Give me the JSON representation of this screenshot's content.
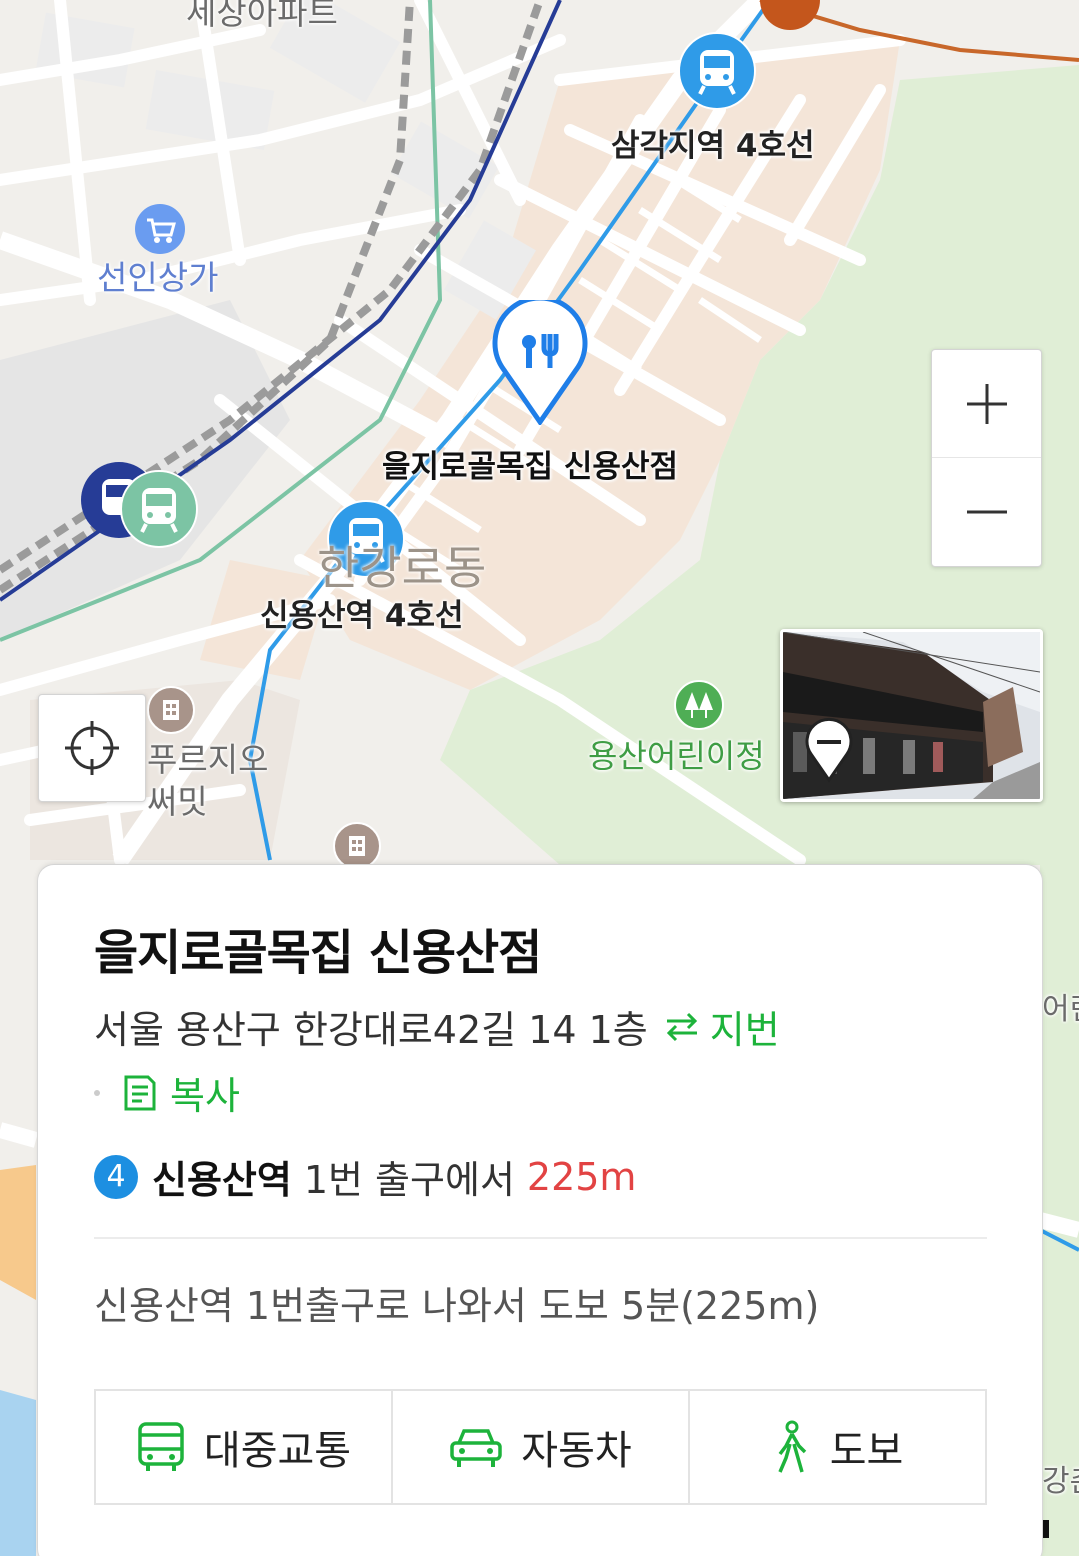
{
  "map": {
    "labels": {
      "top_apartment": "세상아파트",
      "samgakji": "삼각지역 4호선",
      "seonin": "선인상가",
      "poi_name": "을지로골목집 신용산점",
      "dong": "한강로동",
      "sinyongsan": "신용산역 4호선",
      "prugio_1": "푸르지오",
      "prugio_2": "써밋",
      "park": "용산어린이정",
      "edge_right_1": "어린",
      "edge_right_2": "강촌"
    },
    "colors": {
      "subway_blue": "#2f9be8",
      "line1_navy": "#263c96",
      "gyeongui_green": "#7cc4a4",
      "park_green": "#e2efd9",
      "poi_blue": "#1f7ee8"
    }
  },
  "controls": {
    "zoom_in_icon": "plus-icon",
    "zoom_out_icon": "minus-icon",
    "locate_icon": "crosshair-icon",
    "streetview_icon": "streetview-pin-icon"
  },
  "card": {
    "title": "을지로골목집 신용산점",
    "address": "서울 용산구 한강대로42길 14 1층",
    "jibun_label": "지번",
    "copy_label": "복사",
    "subway": {
      "line_number": "4",
      "line_color": "#1d8fe1",
      "station": "신용산역",
      "exit_text": "1번 출구에서",
      "distance": "225m"
    },
    "directions": "신용산역 1번출구로 나와서 도보 5분(225m)",
    "routes": [
      {
        "label": "대중교통",
        "icon": "bus-icon"
      },
      {
        "label": "자동차",
        "icon": "car-icon"
      },
      {
        "label": "도보",
        "icon": "walk-icon"
      }
    ],
    "accent_green": "#1db33b"
  }
}
